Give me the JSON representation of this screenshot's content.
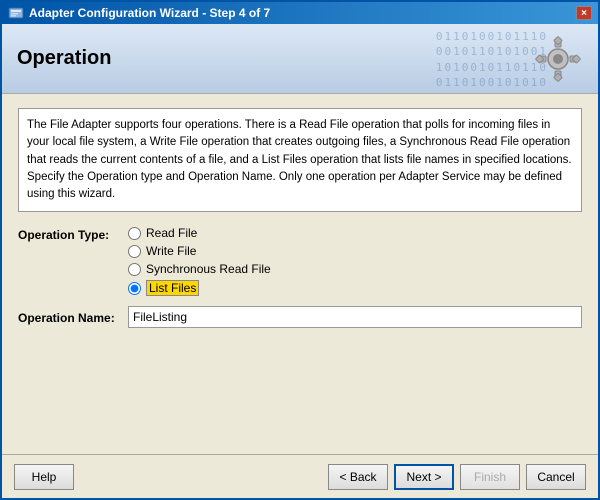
{
  "window": {
    "title": "Adapter Configuration Wizard - Step 4 of 7",
    "close_label": "×"
  },
  "header": {
    "title": "Operation",
    "bg_text": "0110100101\n0010110101\n1010101001"
  },
  "description": {
    "text": "The File Adapter supports four operations.  There is a Read File operation that polls for incoming files in your local file system, a Write File operation that creates outgoing files, a Synchronous Read File operation that reads the current contents of a file, and a List Files operation that lists file names in specified locations.  Specify the Operation type and Operation Name.  Only one operation per Adapter Service may be defined using this wizard."
  },
  "form": {
    "operation_type_label": "Operation Type:",
    "operation_name_label": "Operation Name:",
    "radio_options": [
      {
        "id": "read_file",
        "label": "Read File",
        "selected": false
      },
      {
        "id": "write_file",
        "label": "Write File",
        "selected": false
      },
      {
        "id": "sync_read",
        "label": "Synchronous Read File",
        "selected": false
      },
      {
        "id": "list_files",
        "label": "List Files",
        "selected": true
      }
    ],
    "operation_name_value": "FileListing"
  },
  "footer": {
    "help_label": "Help",
    "back_label": "< Back",
    "next_label": "Next >",
    "finish_label": "Finish",
    "cancel_label": "Cancel"
  }
}
